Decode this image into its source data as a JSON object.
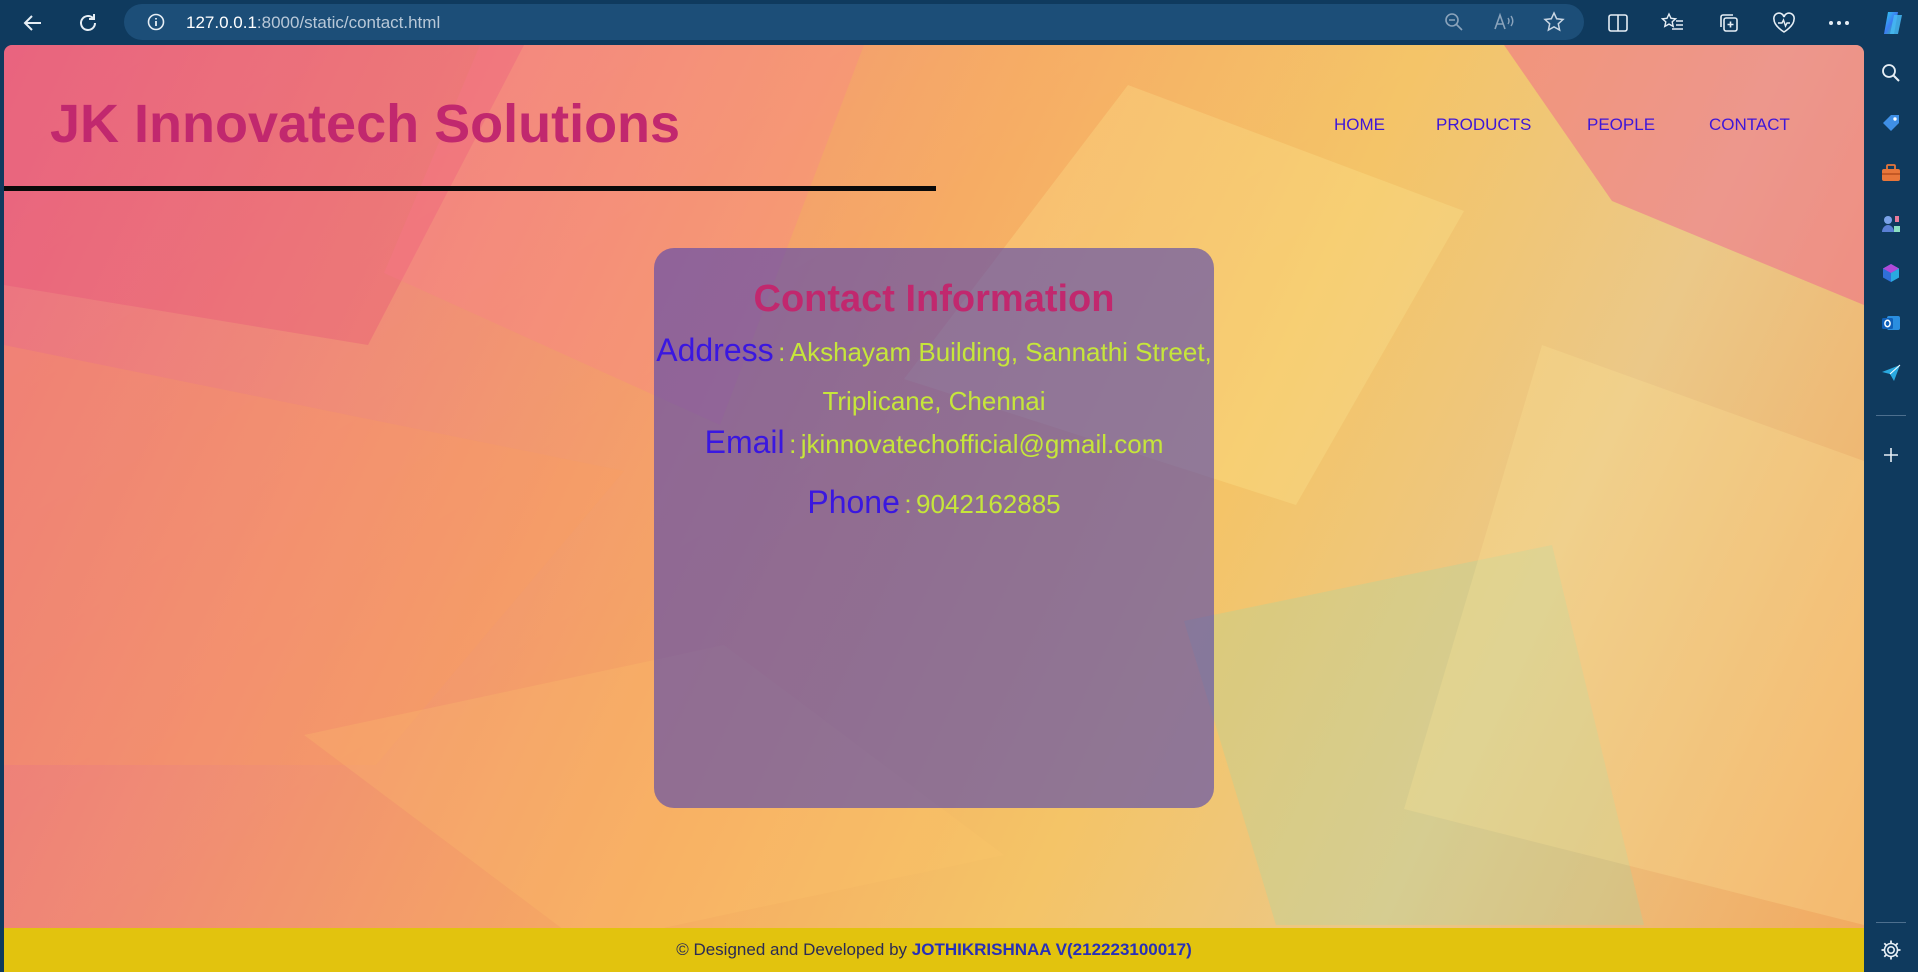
{
  "browser": {
    "url_host": "127.0.0.1",
    "url_path": ":8000/static/contact.html"
  },
  "site": {
    "title": "JK Innovatech Solutions",
    "nav": [
      "HOME",
      "PRODUCTS",
      "PEOPLE",
      "CONTACT"
    ]
  },
  "contact": {
    "heading": "Contact Information",
    "address_label": "Address",
    "address_value": "Akshayam Building, Sannathi Street, Triplicane, Chennai",
    "email_label": "Email",
    "email_value": "jkinnovatechofficial@gmail.com",
    "phone_label": "Phone",
    "phone_value": "9042162885",
    "separator": ":"
  },
  "footer": {
    "prefix": "© Designed and Developed by",
    "author": "JOTHIKRISHNAA V(212223100017)"
  },
  "colors": {
    "title": "#c1286e",
    "nav": "#3e16d9",
    "label": "#3a17e0",
    "value": "#c6e63a",
    "footer_bg": "#e2c30e",
    "chrome_bg": "#0f3a5e"
  }
}
